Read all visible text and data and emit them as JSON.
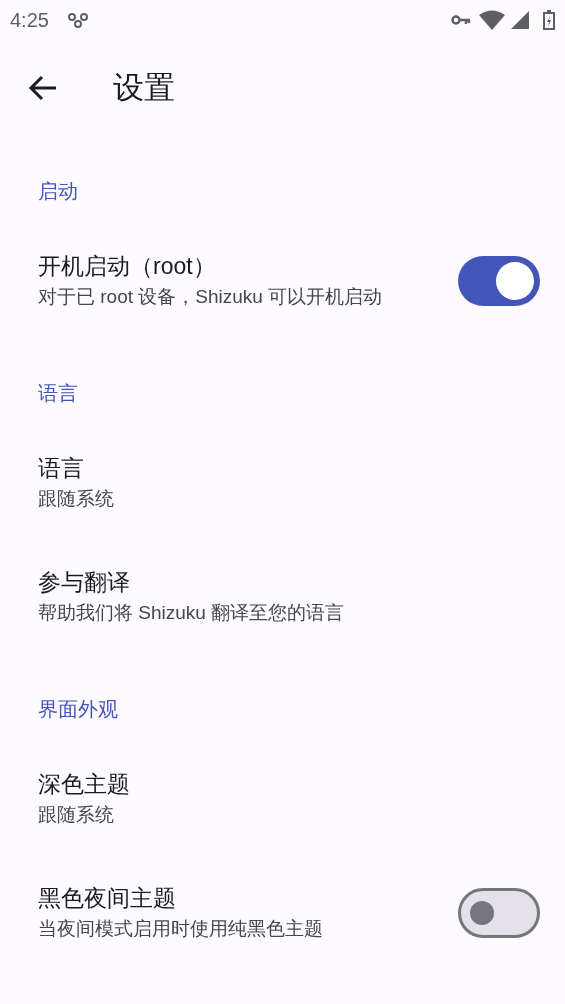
{
  "status_bar": {
    "time": "4:25"
  },
  "app_bar": {
    "title": "设置"
  },
  "sections": [
    {
      "header": "启动",
      "items": [
        {
          "kind": "switch",
          "title": "开机启动（root）",
          "summary": "对于已 root 设备，Shizuku 可以开机启动",
          "on": true
        }
      ]
    },
    {
      "header": "语言",
      "items": [
        {
          "kind": "text",
          "title": "语言",
          "summary": "跟随系统"
        },
        {
          "kind": "text",
          "title": "参与翻译",
          "summary": "帮助我们将 Shizuku 翻译至您的语言"
        }
      ]
    },
    {
      "header": "界面外观",
      "items": [
        {
          "kind": "text",
          "title": "深色主题",
          "summary": "跟随系统"
        },
        {
          "kind": "switch",
          "title": "黑色夜间主题",
          "summary": "当夜间模式启用时使用纯黑色主题",
          "on": false
        }
      ]
    }
  ]
}
